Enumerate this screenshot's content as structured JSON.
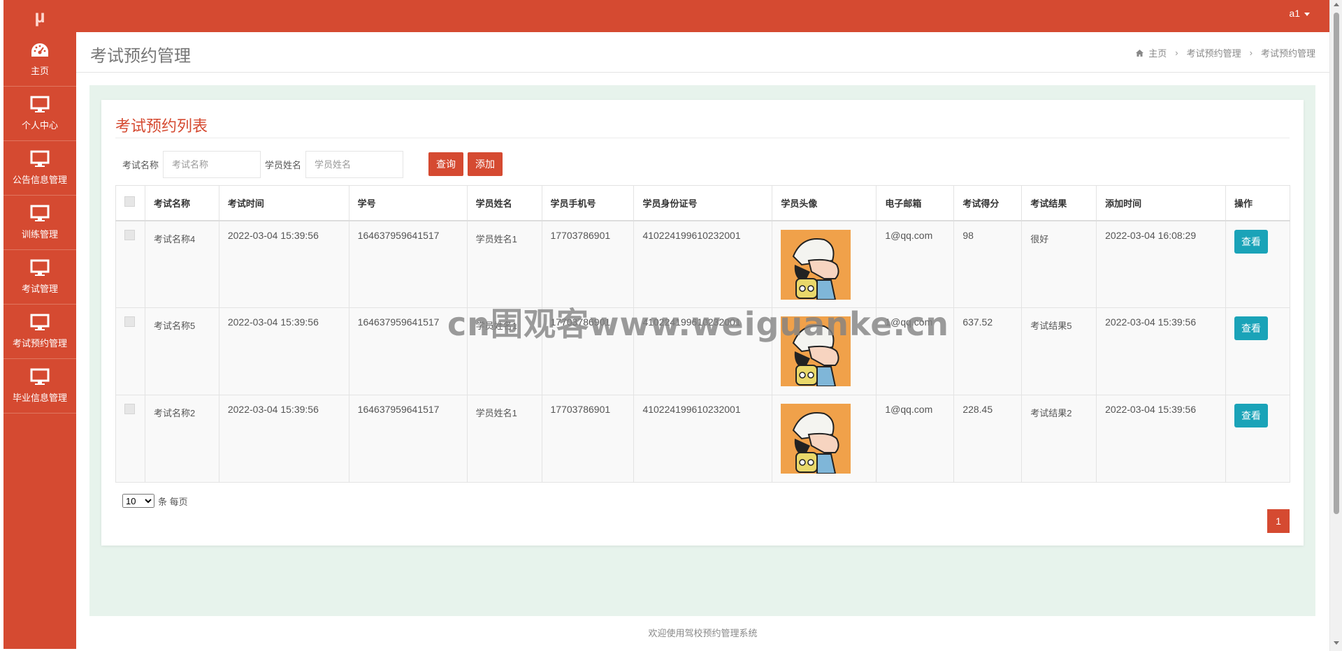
{
  "app": {
    "logo": "µ",
    "user": "a1"
  },
  "colors": {
    "brand": "#d54a31",
    "view_button": "#1aa3b8",
    "content_bg": "#e7f3ec"
  },
  "sidebar": {
    "items": [
      {
        "label": "主页",
        "icon": "dashboard-icon"
      },
      {
        "label": "个人中心",
        "icon": "monitor-icon"
      },
      {
        "label": "公告信息管理",
        "icon": "monitor-icon"
      },
      {
        "label": "训练管理",
        "icon": "monitor-icon"
      },
      {
        "label": "考试管理",
        "icon": "monitor-icon"
      },
      {
        "label": "考试预约管理",
        "icon": "monitor-icon"
      },
      {
        "label": "毕业信息管理",
        "icon": "monitor-icon"
      }
    ]
  },
  "header": {
    "title": "考试预约管理",
    "breadcrumb": [
      "主页",
      "考试预约管理",
      "考试预约管理"
    ]
  },
  "panel": {
    "title": "考试预约列表"
  },
  "search": {
    "exam_name_label": "考试名称",
    "exam_name_placeholder": "考试名称",
    "student_name_label": "学员姓名",
    "student_name_placeholder": "学员姓名",
    "query_label": "查询",
    "add_label": "添加"
  },
  "table": {
    "columns": [
      "考试名称",
      "考试时间",
      "学号",
      "学员姓名",
      "学员手机号",
      "学员身份证号",
      "学员头像",
      "电子邮箱",
      "考试得分",
      "考试结果",
      "添加时间",
      "操作"
    ],
    "rows": [
      {
        "exam_name": "考试名称4",
        "exam_time": "2022-03-04 15:39:56",
        "student_no": "164637959641517",
        "student_name": "学员姓名1",
        "phone": "17703786901",
        "id_card": "410224199610232001",
        "avatar": "cartoon-avatar",
        "email": "1@qq.com",
        "score": "98",
        "result": "很好",
        "added": "2022-03-04 16:08:29",
        "action": "查看"
      },
      {
        "exam_name": "考试名称5",
        "exam_time": "2022-03-04 15:39:56",
        "student_no": "164637959641517",
        "student_name": "学员姓名1",
        "phone": "17703786901",
        "id_card": "410224199610232001",
        "avatar": "cartoon-avatar",
        "email": "1@qq.com",
        "score": "637.52",
        "result": "考试结果5",
        "added": "2022-03-04 15:39:56",
        "action": "查看"
      },
      {
        "exam_name": "考试名称2",
        "exam_time": "2022-03-04 15:39:56",
        "student_no": "164637959641517",
        "student_name": "学员姓名1",
        "phone": "17703786901",
        "id_card": "410224199610232001",
        "avatar": "cartoon-avatar",
        "email": "1@qq.com",
        "score": "228.45",
        "result": "考试结果2",
        "added": "2022-03-04 15:39:56",
        "action": "查看"
      }
    ]
  },
  "pagination": {
    "page_size": "10",
    "page_size_suffix": "条 每页",
    "current_page": "1"
  },
  "footer": {
    "text": "欢迎使用驾校预约管理系统"
  },
  "watermark": "cn围观客www.weiguanke.cn"
}
